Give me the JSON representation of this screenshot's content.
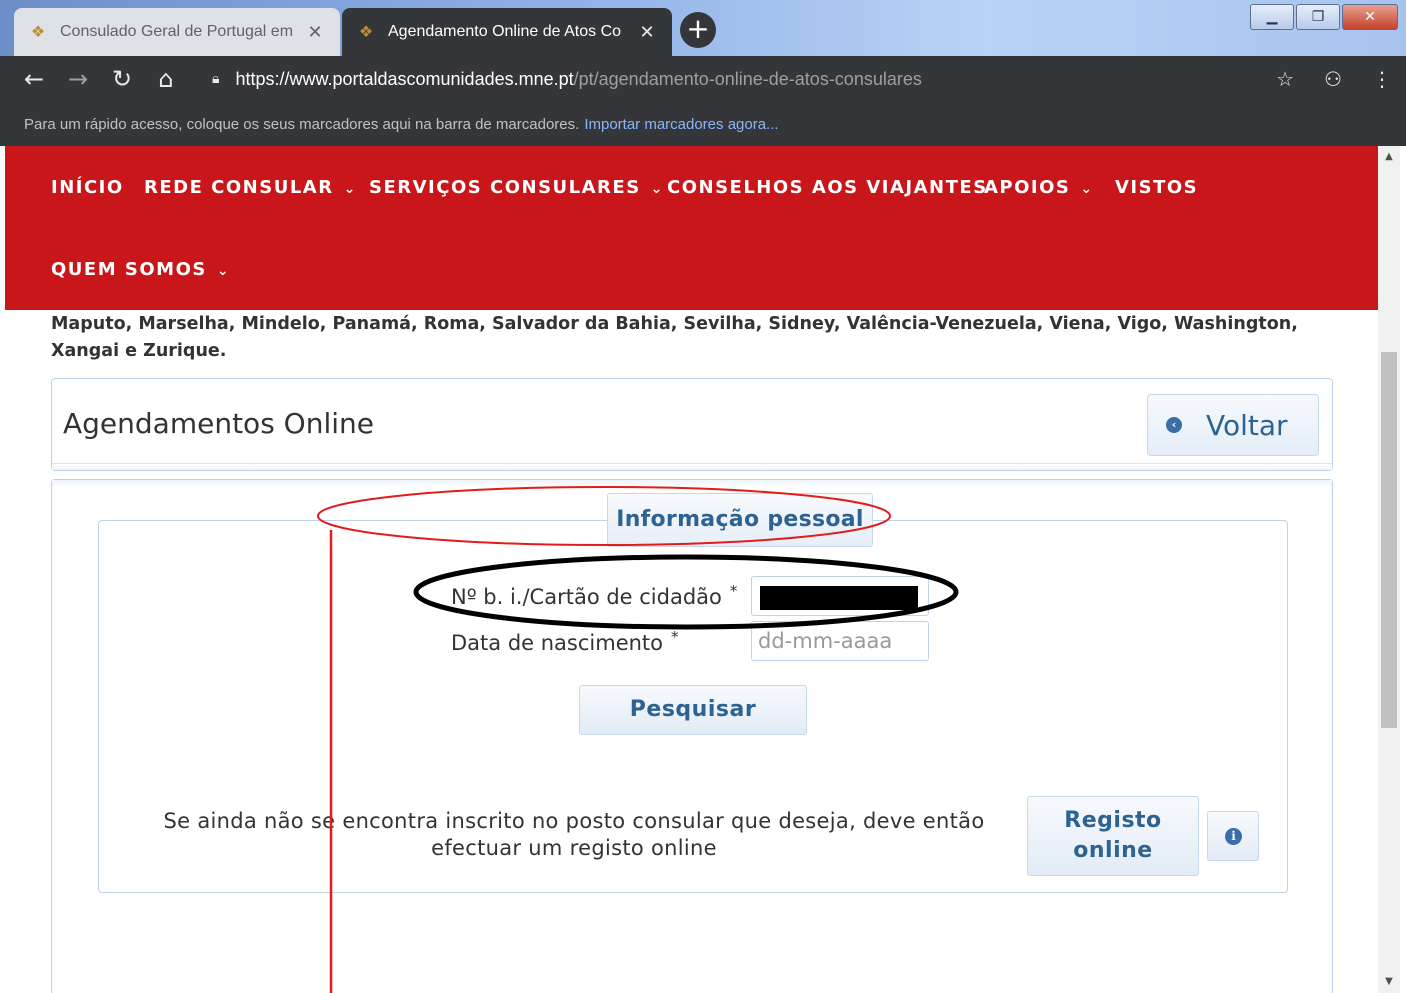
{
  "browser": {
    "tabs": [
      {
        "title": "Consulado Geral de Portugal em",
        "icon": "portugal-crest-icon"
      },
      {
        "title": "Agendamento Online de Atos Co",
        "icon": "portugal-crest-icon"
      }
    ],
    "new_tab_label": "+",
    "url_host": "https://www.portaldascomunidades.mne.pt",
    "url_path": "/pt/agendamento-online-de-atos-consulares",
    "bookmark_bar_text": "Para um rápido acesso, coloque os seus marcadores aqui na barra de marcadores.",
    "bookmark_bar_link": "Importar marcadores agora..."
  },
  "nav": {
    "items": [
      {
        "label": "INÍCIO",
        "has_dropdown": false
      },
      {
        "label": "REDE CONSULAR",
        "has_dropdown": true
      },
      {
        "label": "SERVIÇOS CONSULARES",
        "has_dropdown": true
      },
      {
        "label": "CONSELHOS AOS VIAJANTES",
        "has_dropdown": false
      },
      {
        "label": "APOIOS",
        "has_dropdown": true
      },
      {
        "label": "VISTOS",
        "has_dropdown": false
      },
      {
        "label": "QUEM SOMOS",
        "has_dropdown": true
      }
    ],
    "background": "#c8161b"
  },
  "intro": {
    "cities_text": "Maputo, Marselha, Mindelo, Panamá, Roma, Salvador da Bahia, Sevilha, Sidney, Valência-Venezuela, Viena, Vigo, Washington, Xangai e Zurique."
  },
  "header": {
    "title": "Agendamentos Online",
    "back_button": "Voltar"
  },
  "form": {
    "legend": "Informação pessoal",
    "id_label": "Nº b. i./Cartão de cidadão",
    "id_required": "*",
    "id_value_redacted": true,
    "dob_label": "Data de nascimento",
    "dob_required": "*",
    "dob_placeholder": "dd-mm-aaaa",
    "search_button": "Pesquisar",
    "register_text": "Se ainda não se encontra inscrito no posto consular que deseja, deve então efectuar um registo online",
    "register_button_line1": "Registo",
    "register_button_line2": "online",
    "info_icon": "i"
  },
  "colors": {
    "accent_blue": "#2e6290",
    "annotation_red": "#e31b1b",
    "annotation_black": "#000000"
  }
}
